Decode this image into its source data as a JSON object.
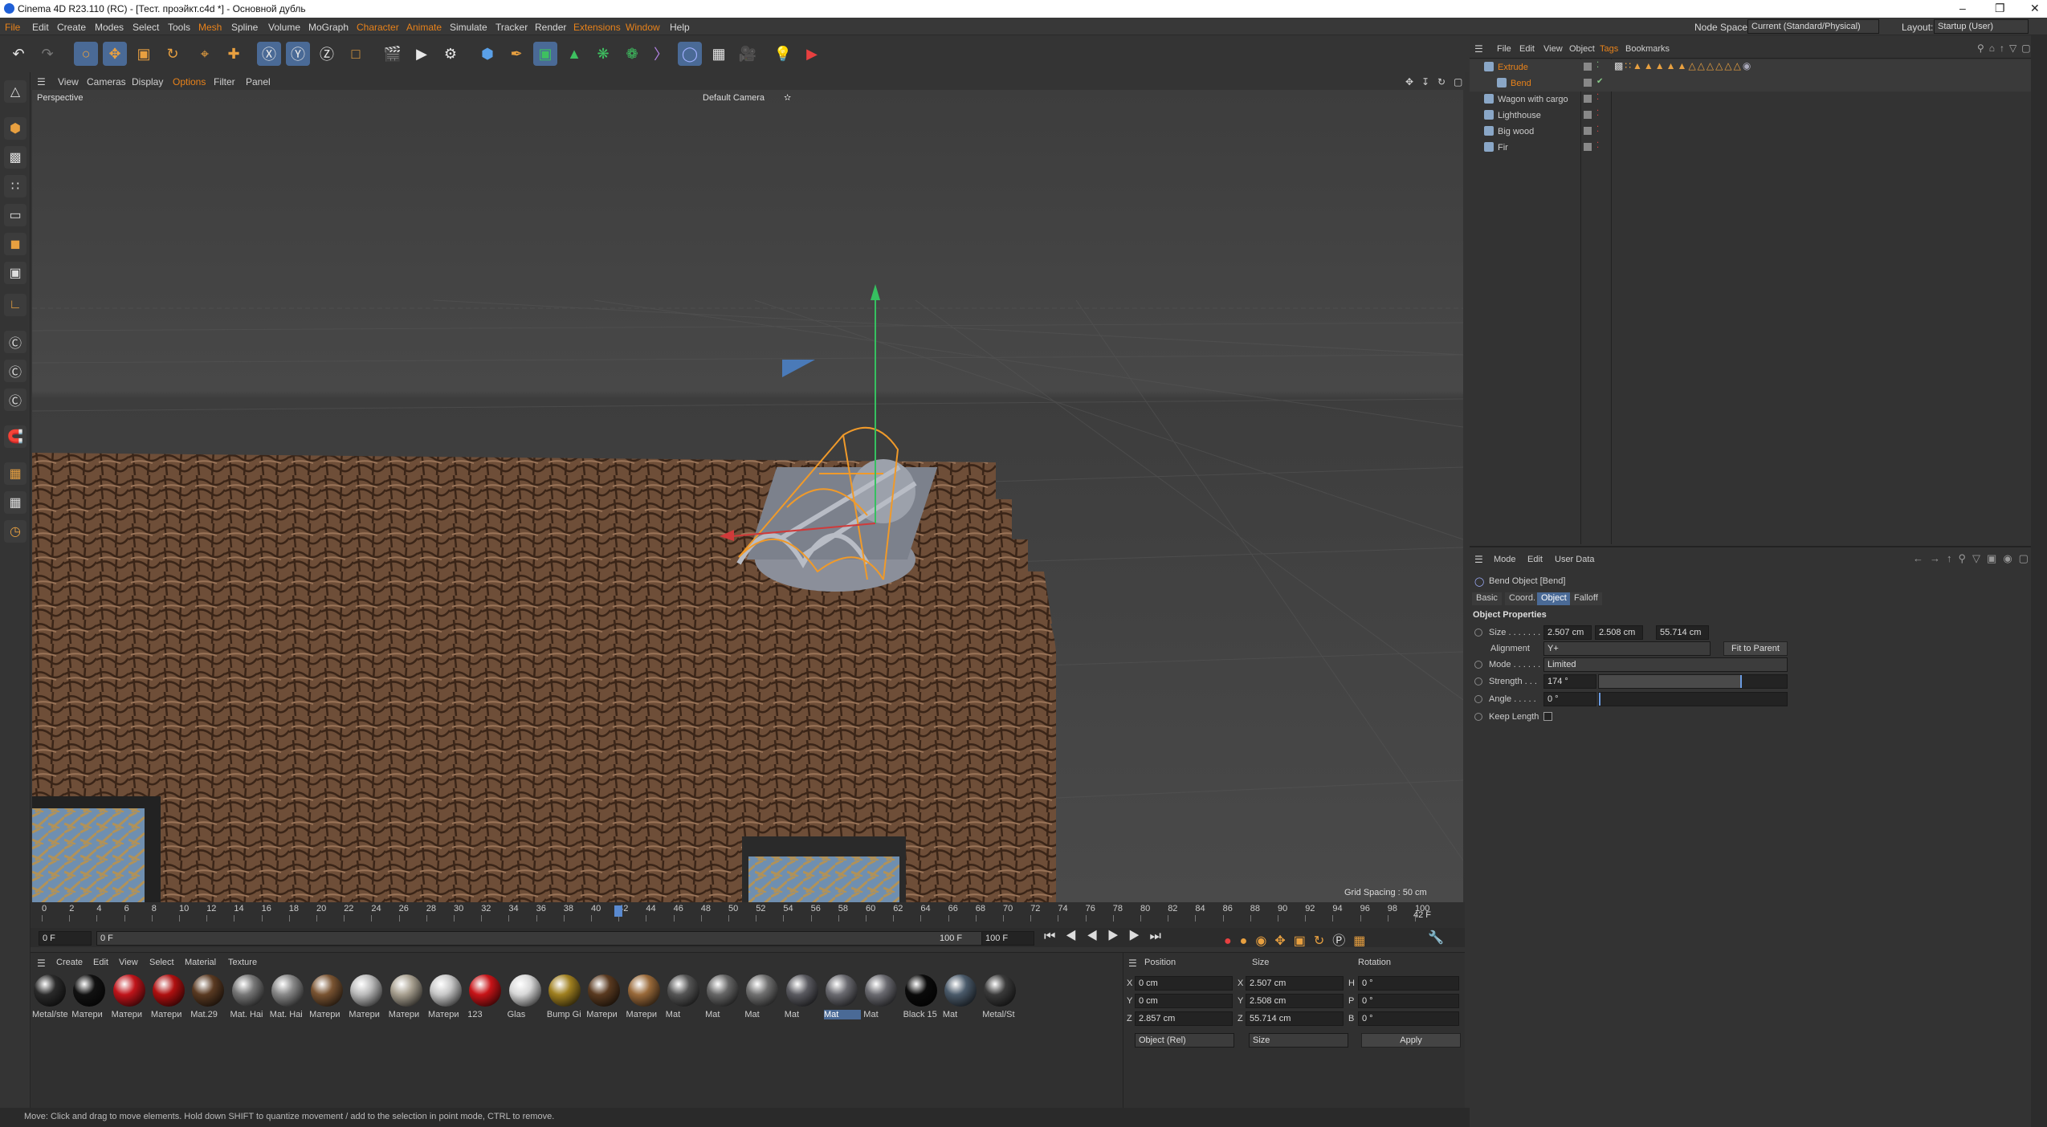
{
  "window": {
    "title": "Cinema 4D R23.110 (RC) - [Тест. проэйкт.c4d *] - Основной дубль"
  },
  "menu": {
    "items": [
      "File",
      "Edit",
      "Create",
      "Modes",
      "Select",
      "Tools",
      "Mesh",
      "Spline",
      "Volume",
      "MoGraph",
      "Character",
      "Animate",
      "Simulate",
      "Tracker",
      "Render",
      "Extensions",
      "Window",
      "Help"
    ],
    "node_space_label": "Node Space:",
    "node_space_value": "Current (Standard/Physical)",
    "layout_label": "Layout:",
    "layout_value": "Startup (User)"
  },
  "viewport": {
    "menu": [
      "View",
      "Cameras",
      "Display",
      "Options",
      "Filter",
      "Panel"
    ],
    "label": "Perspective",
    "camera": "Default Camera",
    "grid_spacing": "Grid Spacing : 50 cm"
  },
  "timeline": {
    "ticks": [
      "0",
      "2",
      "4",
      "6",
      "8",
      "10",
      "12",
      "14",
      "16",
      "18",
      "20",
      "22",
      "24",
      "26",
      "28",
      "30",
      "32",
      "34",
      "36",
      "38",
      "40",
      "42",
      "44",
      "46",
      "48",
      "50",
      "52",
      "54",
      "56",
      "58",
      "60",
      "62",
      "64",
      "66",
      "68",
      "70",
      "72",
      "74",
      "76",
      "78",
      "80",
      "82",
      "84",
      "86",
      "88",
      "90",
      "92",
      "94",
      "96",
      "98",
      "100"
    ],
    "current_frame": "42 F",
    "current_frame_pos": 0.42,
    "start": "0 F",
    "range_start": "0 F",
    "range_end": "100 F",
    "end": "100 F"
  },
  "materials": {
    "menu": [
      "Create",
      "Edit",
      "View",
      "Select",
      "Material",
      "Texture"
    ],
    "items": [
      {
        "label": "Metal/ste",
        "color": "#2a2a2a"
      },
      {
        "label": "Матери",
        "color": "#111"
      },
      {
        "label": "Матери",
        "color": "#c0141a"
      },
      {
        "label": "Матери",
        "color": "#b01010"
      },
      {
        "label": "Mat.29",
        "color": "#5a3a22"
      },
      {
        "label": "Mat. Hai",
        "color": "#777"
      },
      {
        "label": "Mat. Hai",
        "color": "#888"
      },
      {
        "label": "Матери",
        "color": "#7a5432"
      },
      {
        "label": "Матери",
        "color": "#bbb"
      },
      {
        "label": "Матери",
        "color": "#a8a090"
      },
      {
        "label": "Матери",
        "color": "#c8c8c8"
      },
      {
        "label": "123",
        "color": "#c81418"
      },
      {
        "label": "Glas",
        "color": "#d8d8d8"
      },
      {
        "label": "Bump Gi",
        "color": "#a08020"
      },
      {
        "label": "Матери",
        "color": "#5a3a20"
      },
      {
        "label": "Матери",
        "color": "#9a6a3a"
      },
      {
        "label": "Mat",
        "color": "#555"
      },
      {
        "label": "Mat",
        "color": "#666"
      },
      {
        "label": "Mat",
        "color": "#707070"
      },
      {
        "label": "Mat",
        "color": "#5a5a60"
      },
      {
        "label": "Mat",
        "color": "#6a6a70"
      },
      {
        "label": "Mat",
        "color": "#6a6a70"
      },
      {
        "label": "Black 15",
        "color": "#0a0a0a"
      },
      {
        "label": "Mat",
        "color": "#4a5a6a"
      },
      {
        "label": "Metal/St",
        "color": "#3a3a3a"
      }
    ]
  },
  "coordinates": {
    "headers": [
      "Position",
      "Size",
      "Rotation"
    ],
    "rows": [
      {
        "axis": "X",
        "pos": "0 cm",
        "saxis": "X",
        "size": "2.507 cm",
        "raxis": "H",
        "rot": "0 °"
      },
      {
        "axis": "Y",
        "pos": "0 cm",
        "saxis": "Y",
        "size": "2.508 cm",
        "raxis": "P",
        "rot": "0 °"
      },
      {
        "axis": "Z",
        "pos": "2.857 cm",
        "saxis": "Z",
        "size": "55.714 cm",
        "raxis": "B",
        "rot": "0 °"
      }
    ],
    "mode": "Object (Rel)",
    "size_mode": "Size",
    "apply": "Apply"
  },
  "object_manager": {
    "menu": [
      "File",
      "Edit",
      "View",
      "Object",
      "Tags",
      "Bookmarks"
    ],
    "objects": [
      {
        "name": "Extrude",
        "level": 0,
        "color": "#e8821a"
      },
      {
        "name": "Bend",
        "level": 1,
        "color": "#e8821a"
      },
      {
        "name": "Wagon with cargo",
        "level": 0,
        "color": "#ccc"
      },
      {
        "name": "Lighthouse",
        "level": 0,
        "color": "#ccc"
      },
      {
        "name": "Big wood",
        "level": 0,
        "color": "#ccc"
      },
      {
        "name": "Fir",
        "level": 0,
        "color": "#ccc"
      }
    ]
  },
  "attributes": {
    "menu": [
      "Mode",
      "Edit",
      "User Data"
    ],
    "object_title": "Bend Object [Bend]",
    "tabs": [
      "Basic",
      "Coord.",
      "Object",
      "Falloff"
    ],
    "active_tab": "Object",
    "section": "Object Properties",
    "size_label": "Size . . . . . . .",
    "size_x": "2.507 cm",
    "size_y": "2.508 cm",
    "size_z": "55.714 cm",
    "alignment_label": "Alignment",
    "alignment_value": "Y+",
    "fit_to_parent": "Fit to Parent",
    "mode_label": "Mode . . . . . .",
    "mode_value": "Limited",
    "strength_label": "Strength . . .",
    "strength_value": "174 °",
    "strength_fraction": 0.76,
    "angle_label": "Angle . . . . .",
    "angle_value": "0 °",
    "keep_length_label": "Keep Length"
  },
  "status": {
    "text": "Move: Click and drag to move elements. Hold down SHIFT to quantize movement / add to the selection in point mode, CTRL to remove."
  }
}
